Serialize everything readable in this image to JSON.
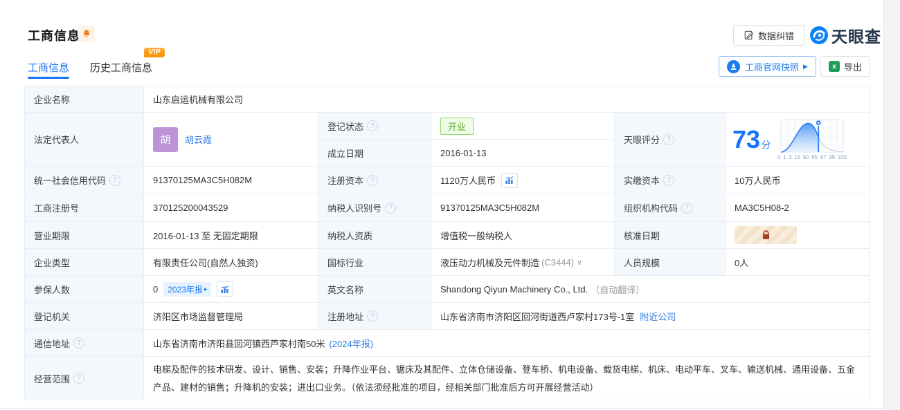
{
  "header": {
    "title": "工商信息",
    "correction": "数据纠错"
  },
  "brand": {
    "name": "天眼查"
  },
  "tabs": [
    {
      "label": "工商信息",
      "active": true
    },
    {
      "label": "历史工商信息",
      "vip": "VIP"
    }
  ],
  "actions": {
    "snapshot": "工商官网快照",
    "export": "导出"
  },
  "icons": {
    "help": "?",
    "chevron_down": "∨",
    "play_arrow": "▶",
    "small_arrow": "▸"
  },
  "colors": {
    "accent": "#1a7af0",
    "link": "#2e7ce0",
    "open_green": "#50a820",
    "vip_orange": "#f79100",
    "avatar_purple": "#bd93d8",
    "label_bg": "#f3f8fd"
  },
  "fields": {
    "company_name": {
      "label": "企业名称",
      "value": "山东启运机械有限公司"
    },
    "legal_rep": {
      "label": "法定代表人",
      "avatar": "胡",
      "value": "胡云霞"
    },
    "reg_status": {
      "label": "登记状态",
      "value": "开业"
    },
    "est_date": {
      "label": "成立日期",
      "value": "2016-01-13"
    },
    "score": {
      "label": "天眼评分",
      "value": "73",
      "unit": "分",
      "axis": [
        "0",
        "1",
        "3",
        "15",
        "50",
        "85",
        "97",
        "99",
        "100"
      ]
    },
    "credit_code": {
      "label": "统一社会信用代码",
      "value": "91370125MA3C5H082M"
    },
    "reg_capital": {
      "label": "注册资本",
      "value": "1120万人民币"
    },
    "paid_capital": {
      "label": "实缴资本",
      "value": "10万人民币"
    },
    "reg_number": {
      "label": "工商注册号",
      "value": "370125200043529"
    },
    "taxpayer_id": {
      "label": "纳税人识别号",
      "value": "91370125MA3C5H082M"
    },
    "org_code": {
      "label": "组织机构代码",
      "value": "MA3C5H08-2"
    },
    "business_term": {
      "label": "营业期限",
      "value": "2016-01-13 至 无固定期限"
    },
    "taxpayer_quality": {
      "label": "纳税人资质",
      "value": "增值税一般纳税人"
    },
    "approval_date": {
      "label": "核准日期"
    },
    "company_type": {
      "label": "企业类型",
      "value": "有限责任公司(自然人独资)"
    },
    "industry": {
      "label": "国标行业",
      "value": "液压动力机械及元件制造",
      "code": "(C3444)"
    },
    "staff_size": {
      "label": "人员规模",
      "value": "0人"
    },
    "insured": {
      "label": "参保人数",
      "value": "0",
      "badge": "2023年报"
    },
    "english_name": {
      "label": "英文名称",
      "value": "Shandong Qiyun Machinery Co., Ltd.",
      "note": "（自动翻译）"
    },
    "reg_authority": {
      "label": "登记机关",
      "value": "济阳区市场监督管理局"
    },
    "reg_address": {
      "label": "注册地址",
      "value": "山东省济南市济阳区回河街道西卢家村173号-1室",
      "link": "附近公司"
    },
    "mail_address": {
      "label": "通信地址",
      "value": "山东省济南市济阳县回河镇西芦家村南50米",
      "link": "(2024年报)"
    },
    "business_scope": {
      "label": "经营范围",
      "value": "电梯及配件的技术研发、设计、销售、安装；升降作业平台、锯床及其配件、立体仓储设备、登车桥、机电设备、载货电梯、机床、电动平车、叉车、输送机械、通用设备、五金产品、建材的销售；升降机的安装；进出口业务。（依法须经批准的项目，经相关部门批准后方可开展经营活动）"
    }
  }
}
